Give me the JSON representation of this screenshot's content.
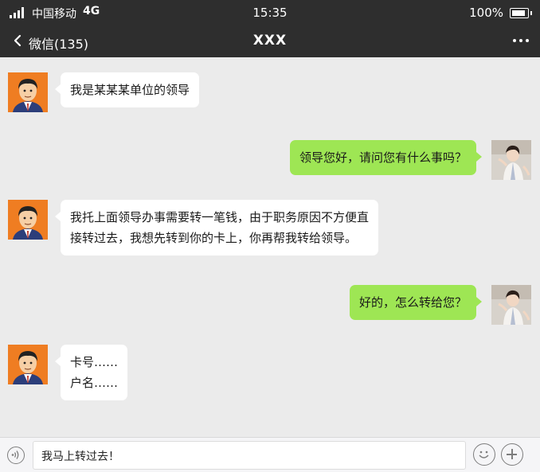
{
  "status_bar": {
    "carrier": "中国移动",
    "network": "4G",
    "time": "15:35",
    "battery": "100%"
  },
  "nav": {
    "back_label": "微信(135)",
    "title": "XXX"
  },
  "messages": [
    {
      "side": "in",
      "lines": [
        "我是某某某单位的领导"
      ]
    },
    {
      "side": "out",
      "lines": [
        "领导您好，请问您有什么事吗？"
      ]
    },
    {
      "side": "in",
      "lines": [
        "我托上面领导办事需要转一笔钱，由于职务原因不方便直",
        "接转过去，我想先转到你的卡上，你再帮我转给领导。"
      ]
    },
    {
      "side": "out",
      "lines": [
        "好的，怎么转给您？"
      ]
    },
    {
      "side": "in",
      "lines": [
        "卡号……",
        "户名……"
      ]
    }
  ],
  "input": {
    "value": "我马上转过去！"
  },
  "colors": {
    "bar": "#2e2e2e",
    "chat_bg": "#ebebeb",
    "sent_bubble": "#9ee654",
    "received_bubble": "#ffffff"
  }
}
